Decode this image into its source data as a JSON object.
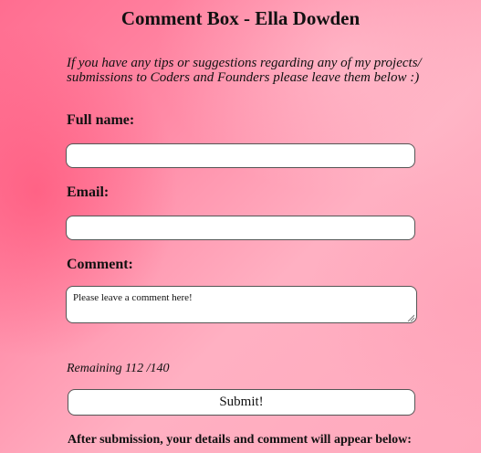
{
  "header": {
    "title": "Comment Box - Ella Dowden"
  },
  "intro": {
    "text": "If you have any tips or suggestions regarding any of my projects/ submissions to Coders and Founders please leave them below :)"
  },
  "form": {
    "name_label": "Full name:",
    "name_value": "",
    "email_label": "Email:",
    "email_value": "",
    "comment_label": "Comment:",
    "comment_value": "Please leave a comment here!",
    "remaining_text": "Remaining 112 /140",
    "submit_label": "Submit!"
  },
  "footer": {
    "after_submission_text": "After submission, your details and comment will appear below:"
  }
}
